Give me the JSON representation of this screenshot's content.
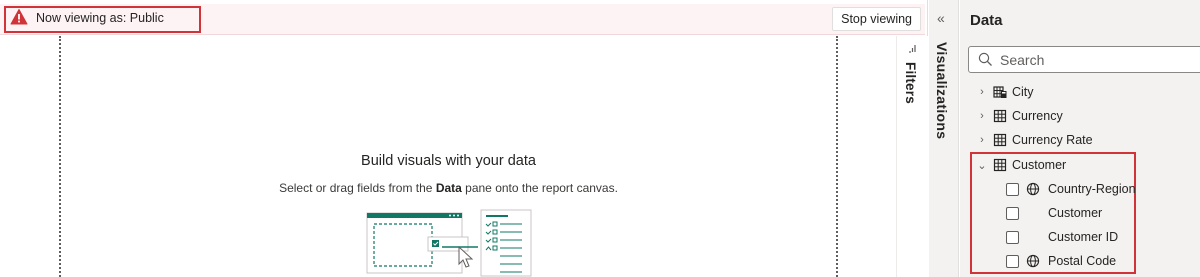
{
  "banner": {
    "message": "Now viewing as: Public",
    "stop_label": "Stop viewing"
  },
  "canvas": {
    "title": "Build visuals with your data",
    "subtitle_before": "Select or drag fields from the ",
    "subtitle_bold": "Data",
    "subtitle_after": " pane onto the report canvas."
  },
  "filters": {
    "label": "Filters"
  },
  "visualizations": {
    "label": "Visualizations",
    "collapse_glyph": "«"
  },
  "data_pane": {
    "title": "Data",
    "search_placeholder": "Search",
    "tables": [
      {
        "name": "City",
        "expanded": false,
        "icon": "calculated-table-icon"
      },
      {
        "name": "Currency",
        "expanded": false,
        "icon": "table-icon"
      },
      {
        "name": "Currency Rate",
        "expanded": false,
        "icon": "table-icon"
      },
      {
        "name": "Customer",
        "expanded": true,
        "icon": "table-icon"
      }
    ],
    "customer_fields": [
      {
        "name": "Country-Region",
        "icon": "globe-icon",
        "checked": false
      },
      {
        "name": "Customer",
        "icon": "",
        "checked": false
      },
      {
        "name": "Customer ID",
        "icon": "",
        "checked": false
      },
      {
        "name": "Postal Code",
        "icon": "globe-icon",
        "checked": false
      }
    ]
  },
  "colors": {
    "accent_green": "#117865",
    "warning_red": "#d13438",
    "banner_bg": "#fdf3f4",
    "pane_bg": "#f3f2f1"
  }
}
